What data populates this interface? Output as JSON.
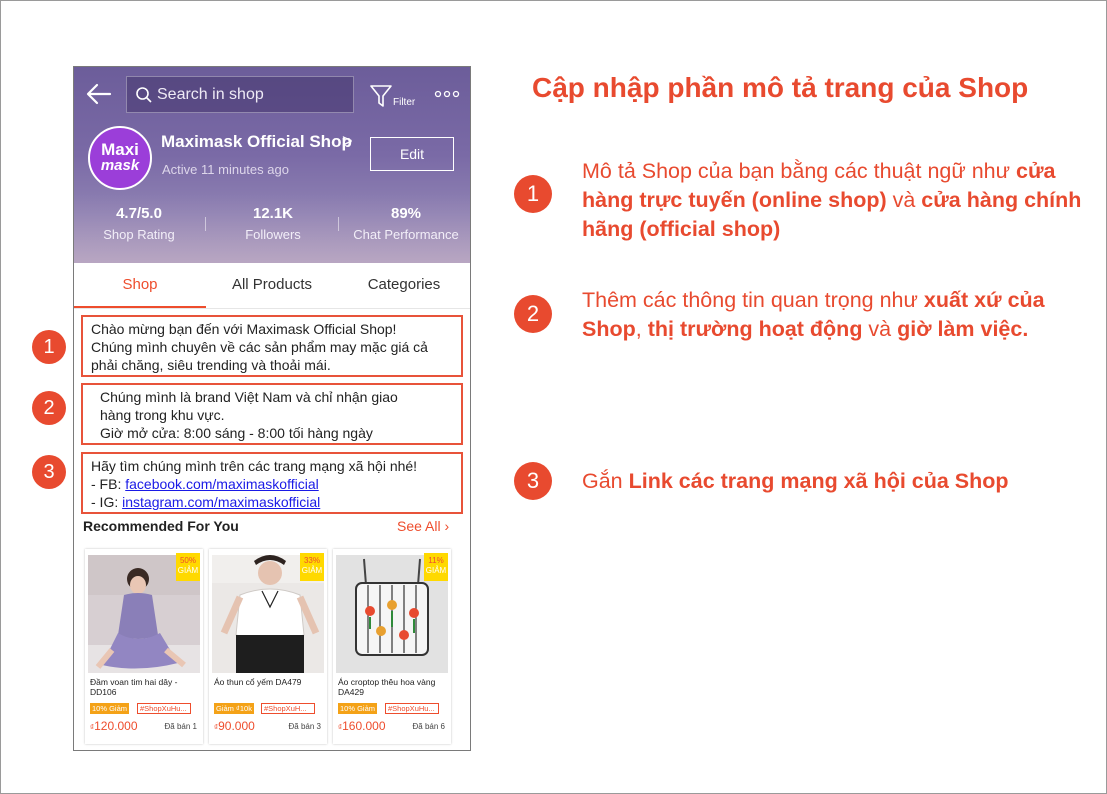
{
  "phone": {
    "search_placeholder": "Search in shop",
    "filter_label": "Filter",
    "shop": {
      "avatar_line1": "Maxi",
      "avatar_line2": "mask",
      "name": "Maximask Official Shop",
      "chevron": ">",
      "active": "Active 11 minutes ago",
      "edit_label": "Edit"
    },
    "stats": [
      {
        "value": "4.7/5.0",
        "label": "Shop Rating"
      },
      {
        "value": "12.1K",
        "label": "Followers"
      },
      {
        "value": "89%",
        "label": "Chat Performance"
      }
    ],
    "tabs": [
      {
        "label": "Shop"
      },
      {
        "label": "All Products"
      },
      {
        "label": "Categories"
      }
    ],
    "description": {
      "block1": {
        "line1": "Chào mừng bạn đến với Maximask Official Shop!",
        "line2": "Chúng mình chuyên về các sản phẩm may mặc giá cả",
        "line3": "phải chăng, siêu trending và thoải mái."
      },
      "block2": {
        "line1": "Chúng mình là brand Việt Nam và chỉ nhận giao",
        "line2": "hàng trong khu vực.",
        "line3": "Giờ mở cửa: 8:00 sáng - 8:00 tối hàng ngày"
      },
      "block3": {
        "line1": "Hãy tìm chúng mình trên các trang mạng xã hội nhé!",
        "fb_prefix": "- FB: ",
        "fb_link": "facebook.com/maximaskofficial",
        "ig_prefix": "- IG: ",
        "ig_link": "instagram.com/maximaskofficial"
      }
    },
    "recommended_title": "Recommended For You",
    "see_all": "See All",
    "products": [
      {
        "discount_pct": "50%",
        "discount_word": "GIẢM",
        "name": "Đầm voan tim hai dây - DD106",
        "tag1": "10% Giảm",
        "tag2": "#ShopXuHu...",
        "currency": "₫",
        "price": "120.000",
        "sold": "Đã bán 1"
      },
      {
        "discount_pct": "33%",
        "discount_word": "GIẢM",
        "name": "Áo thun cổ yếm DA479",
        "tag1": "Giảm ₫10k",
        "tag2": "#ShopXuH...",
        "currency": "₫",
        "price": "90.000",
        "sold": "Đã bán 3"
      },
      {
        "discount_pct": "11%",
        "discount_word": "GIẢM",
        "name": "Áo croptop thêu hoa vàng DA429",
        "tag1": "10% Giảm",
        "tag2": "#ShopXuHu...",
        "currency": "₫",
        "price": "160.000",
        "sold": "Đã bán 6"
      }
    ],
    "badges": [
      "1",
      "2",
      "3"
    ]
  },
  "right": {
    "headline": "Cập nhập phần mô tả trang của Shop",
    "badges": [
      "1",
      "2",
      "3"
    ],
    "note1": {
      "t1": "Mô tả Shop của bạn bằng các thuật ngữ như ",
      "b1": "cửa hàng trực tuyến (online shop)",
      "t2": " và ",
      "b2": "cửa hàng chính hãng (official shop)"
    },
    "note2": {
      "t1": "Thêm các thông tin quan trọng như ",
      "b1": "xuất xứ của Shop",
      "t2": ", ",
      "b2": "thị trường hoạt động",
      "t3": " và ",
      "b3": "giờ làm việc."
    },
    "note3": {
      "t1": "Gắn ",
      "b1": "Link các trang mạng xã hội của Shop"
    }
  },
  "colors": {
    "accent": "#e84a2f",
    "shopee_orange": "#ee4d2d",
    "header_purple": "#6c5d9a",
    "link_blue": "#1a1ae6"
  },
  "icons": [
    "back-arrow-icon",
    "search-icon",
    "filter-icon",
    "more-dots-icon",
    "chevron-right-icon"
  ]
}
